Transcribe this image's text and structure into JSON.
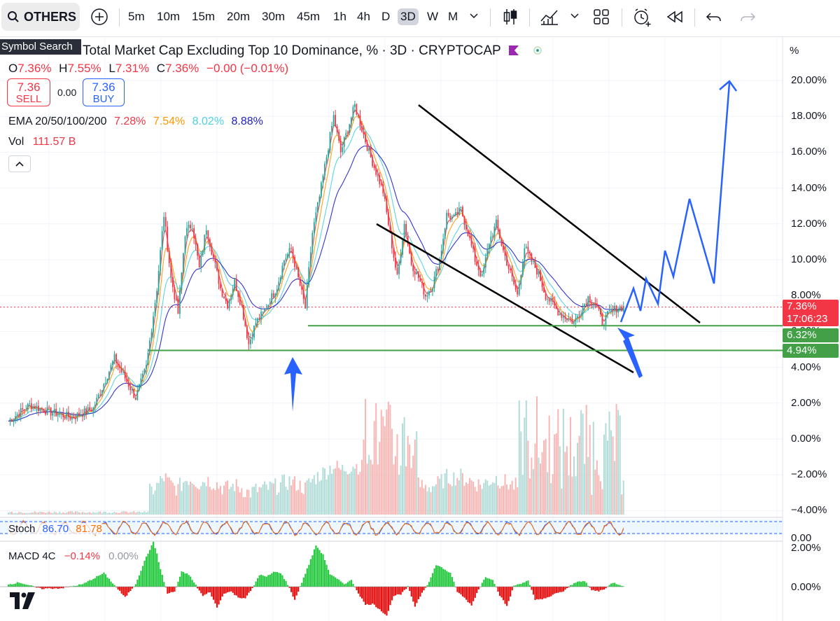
{
  "toolbar": {
    "symbol": "OTHERS",
    "intervals": [
      "5m",
      "10m",
      "15m",
      "20m",
      "30m",
      "45m",
      "1h",
      "4h",
      "D",
      "3D",
      "W",
      "M"
    ],
    "active_interval": "3D",
    "tooltip": "Symbol Search"
  },
  "legend": {
    "title": "Total Market Cap Excluding Top 10 Dominance, % · 3D · CRYPTOCAP",
    "open_key": "O",
    "open": "7.36%",
    "high_key": "H",
    "high": "7.55%",
    "low_key": "L",
    "low": "7.31%",
    "close_key": "C",
    "close": "7.36%",
    "change": "−0.00 (−0.01%)",
    "sell_price": "7.36",
    "sell_label": "SELL",
    "spread": "0.00",
    "buy_price": "7.36",
    "buy_label": "BUY",
    "ema_label": "EMA 20/50/100/200",
    "ema20": "7.28%",
    "ema50": "7.54%",
    "ema100": "8.02%",
    "ema200": "8.88%",
    "vol_label": "Vol",
    "vol_value": "111.57 B"
  },
  "indicators": {
    "stoch_label": "Stoch",
    "stoch_k": "86.70",
    "stoch_d": "81.78",
    "macd_label": "MACD 4C",
    "macd_value": "−0.14%",
    "macd_signal": "0.00%"
  },
  "axis": {
    "unit": "%",
    "main_labels": [
      "20.00%",
      "18.00%",
      "16.00%",
      "14.00%",
      "12.00%",
      "10.00%",
      "8.00%",
      "6.00%",
      "4.00%",
      "2.00%",
      "0.00%",
      "−2.00%",
      "−4.00%"
    ],
    "stoch_labels": [
      "0.00"
    ],
    "macd_labels": [
      "2.00%",
      "0.00%"
    ],
    "price_tag": "7.36%",
    "countdown": "17:06:23",
    "support_upper_tag": "6.32%",
    "support_lower_tag": "4.94%"
  },
  "colors": {
    "up": "#26a69a",
    "down": "#f23645",
    "ema20": "#f23645",
    "ema50": "#ff9800",
    "ema100": "#4dd0e1",
    "ema200": "#1e1ec8",
    "support": "#43a047",
    "projection": "#2962ff",
    "macd_up": "#26c940",
    "macd_down": "#e81010"
  },
  "chart_data": {
    "type": "line",
    "title": "Total Market Cap Excluding Top 10 Dominance, % · 3D · CRYPTOCAP",
    "ylabel": "%",
    "ylim": [
      -4.0,
      20.5
    ],
    "grid": true,
    "series": [
      {
        "name": "OTHERS",
        "x": [
          0,
          3,
          6,
          9,
          12,
          15,
          18,
          19.5,
          21,
          22,
          23,
          24,
          25,
          26,
          27,
          28,
          30,
          31,
          32,
          33,
          34,
          35,
          36,
          38,
          39,
          40,
          42,
          43,
          44,
          46,
          47,
          49,
          51,
          53,
          55,
          56,
          57,
          58,
          59,
          60,
          61,
          62,
          63,
          64,
          65,
          66,
          67,
          68,
          69,
          70,
          72,
          73,
          75,
          76,
          78,
          80,
          82,
          83,
          84,
          85,
          86,
          87
        ],
        "y": [
          1.0,
          1.9,
          1.5,
          1.2,
          1.7,
          4.5,
          2.3,
          4.0,
          8.4,
          12.5,
          9.0,
          7.0,
          11.5,
          12.0,
          9.5,
          11.8,
          8.4,
          7.5,
          8.8,
          7.4,
          5.3,
          6.5,
          7.0,
          8.5,
          10.0,
          10.6,
          7.3,
          11.5,
          13.5,
          18.0,
          16.0,
          18.6,
          16.0,
          13.8,
          9.0,
          12.0,
          9.8,
          9.0,
          8.0,
          8.6,
          10.0,
          12.5,
          12.3,
          12.8,
          11.5,
          10.0,
          9.0,
          11.0,
          12.0,
          10.5,
          8.0,
          10.7,
          9.2,
          8.0,
          7.0,
          6.5,
          7.9,
          7.6,
          6.5,
          7.0,
          7.3,
          7.36
        ]
      },
      {
        "name": "EMA 20",
        "value": 7.28
      },
      {
        "name": "EMA 50",
        "value": 7.54
      },
      {
        "name": "EMA 100",
        "value": 8.02
      },
      {
        "name": "EMA 200",
        "value": 8.88
      }
    ],
    "horizontal_levels": [
      6.32,
      4.94
    ],
    "annotations": [
      "descending channel",
      "projection path",
      "support arrows"
    ]
  }
}
